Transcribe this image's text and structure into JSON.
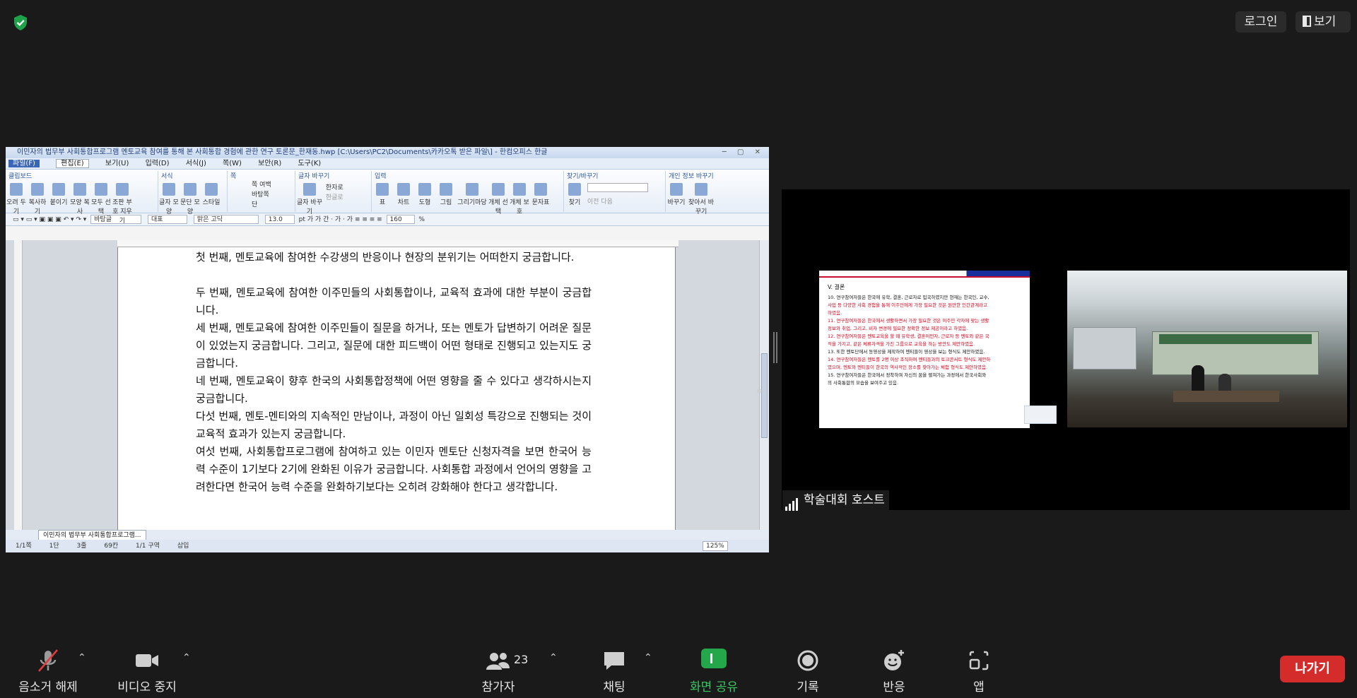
{
  "top": {
    "login_label": "로그인",
    "view_label": "보기"
  },
  "app": {
    "title": "이민자의 법무부 사회통합프로그램 멘토교육 참여를 통해 본 사회통합 경험에 관한 연구 토론문_한재동.hwp [C:\\Users\\PC2\\Documents\\카카오톡 받은 파일\\] - 한컴오피스 한글",
    "menu": [
      "파일(F)",
      "편집(E)",
      "보기(U)",
      "입력(D)",
      "서식(J)",
      "쪽(W)",
      "보안(R)",
      "도구(K)"
    ],
    "ribbon_groups": [
      {
        "title": "클립보드",
        "items": [
          "오려 두기",
          "복사하기",
          "붙이기",
          "모양 복사",
          "모두 선택",
          "조판 부호 지우기"
        ]
      },
      {
        "title": "서식",
        "items": [
          "글자 모양",
          "문단 모양",
          "스타일"
        ]
      },
      {
        "title": "쪽",
        "items": [
          "쪽 여백",
          "바탕쪽",
          "단"
        ]
      },
      {
        "title": "글자 바꾸기",
        "items": [
          "글자 바꾸기",
          "한자로",
          "한글로"
        ]
      },
      {
        "title": "입력",
        "items": [
          "표",
          "차트",
          "도형",
          "그림",
          "그리기마당",
          "개체 선택",
          "개체 보호",
          "문자표"
        ]
      },
      {
        "title": "찾기/바꾸기",
        "items": [
          "찾기",
          "이전",
          "다음"
        ]
      },
      {
        "title": "개인 정보 바꾸기",
        "items": [
          "바꾸기",
          "찾아서 바꾸기"
        ]
      }
    ],
    "fmt": {
      "style": "바탕글",
      "lang": "대표",
      "font": "맑은 고딕",
      "size": "13.0",
      "unit": "pt",
      "line_spacing": "160",
      "pct": "%"
    },
    "paragraphs": [
      "첫 번째, 멘토교육에 참여한 수강생의 반응이나 현장의 분위기는 어떠한지 궁금합니다.",
      "두 번째, 멘토교육에 참여한 이주민들의 사회통합이나, 교육적 효과에 대한 부분이 궁금합니다.",
      "세 번째, 멘토교육에 참여한 이주민들이 질문을 하거나, 또는 멘토가 답변하기 어려운 질문이 있었는지 궁금합니다. 그리고, 질문에 대한 피드백이 어떤 형태로 진행되고 있는지도 궁금합니다.",
      "네 번째, 멘토교육이 향후 한국의 사회통합정책에 어떤 영향을 줄 수 있다고 생각하시는지 궁금합니다.",
      "다섯 번째, 멘토-멘티와의 지속적인 만남이나, 과정이 아닌 일회성 특강으로 진행되는 것이 교육적 효과가 있는지 궁금합니다.",
      "여섯 번째, 사회통합프로그램에 참여하고 있는 이민자 멘토단 신청자격을 보면 한국어 능력 수준이 1기보다 2기에 완화된 이유가 궁금합니다. 사회통합 과정에서 언어의 영향을 고려한다면 한국어 능력 수준을 완화하기보다는 오히려 강화해야 한다고 생각합니다."
    ],
    "doc_tab": "이민자의 법무부 사회통합프로그램...",
    "status": [
      "1/1쪽",
      "1단",
      "3줄",
      "69칸",
      "1/1 구역",
      "삽입"
    ],
    "zoom": "125%"
  },
  "slide": {
    "title": "V. 결론",
    "lines": [
      {
        "text": "10. 연구참여자들은 한국에 유학, 결혼, 근로자로 입국하였지만 현재는 한국인, 교수,",
        "color": "black"
      },
      {
        "text": "사업 등 다양한 사회 경험을 통해 이주민에게 가장 필요한 것은 원만한 인간관계라고",
        "color": "red"
      },
      {
        "text": "하였음.",
        "color": "red"
      },
      {
        "text": "11. 연구참여자들은 한국에서 생활하면서 가장 필요한 것은 이주민 각자에 맞는 생활",
        "color": "red"
      },
      {
        "text": "정보와 취업, 그리고, 비자 변경에 필요한 정확한 정보 제공이라고 하였음.",
        "color": "red"
      },
      {
        "text": "12. 연구참여자들은 멘토교육을 할 때 유학생, 결혼이민자, 근로자 등 멘토와 같은 국",
        "color": "red"
      },
      {
        "text": "적을 가지고, 같은 체류자격을 가진 그룹으로 교육을 하는 방안도 제안하였음.",
        "color": "red"
      },
      {
        "text": "13. 또한 멘토단에서 동영상을 제작하여 멘티들이 영상을 보는 형식도 제안하였음.",
        "color": "black"
      },
      {
        "text": "14. 연구참여자들은 멘토를 2명 이상 조직하여 멘티들과의 토크콘서트 형식도 제안하",
        "color": "red"
      },
      {
        "text": "였으며, 멘토와 멘티들이 한국의 역사적인 장소를 찾아가는 체험 형식도 제안하였음.",
        "color": "red"
      },
      {
        "text": "15. 연구참여자들은 한국에서 정착하며 자신의 꿈을 펼쳐가는 과정에서 한국사회와",
        "color": "black"
      },
      {
        "text": "의 사회통합의 모습을 보여주고 있음.",
        "color": "black"
      }
    ]
  },
  "participant": {
    "name": "학술대회 호스트"
  },
  "toolbar": {
    "mute_label": "음소거 해제",
    "video_label": "비디오 중지",
    "participants_label": "참가자",
    "participants_count": "23",
    "chat_label": "채팅",
    "share_label": "화면 공유",
    "record_label": "기록",
    "reactions_label": "반응",
    "apps_label": "앱",
    "leave_label": "나가기"
  },
  "colors": {
    "share_green": "#24a64a",
    "leave_red": "#d42b2b",
    "shield_green": "#1fa34a"
  }
}
